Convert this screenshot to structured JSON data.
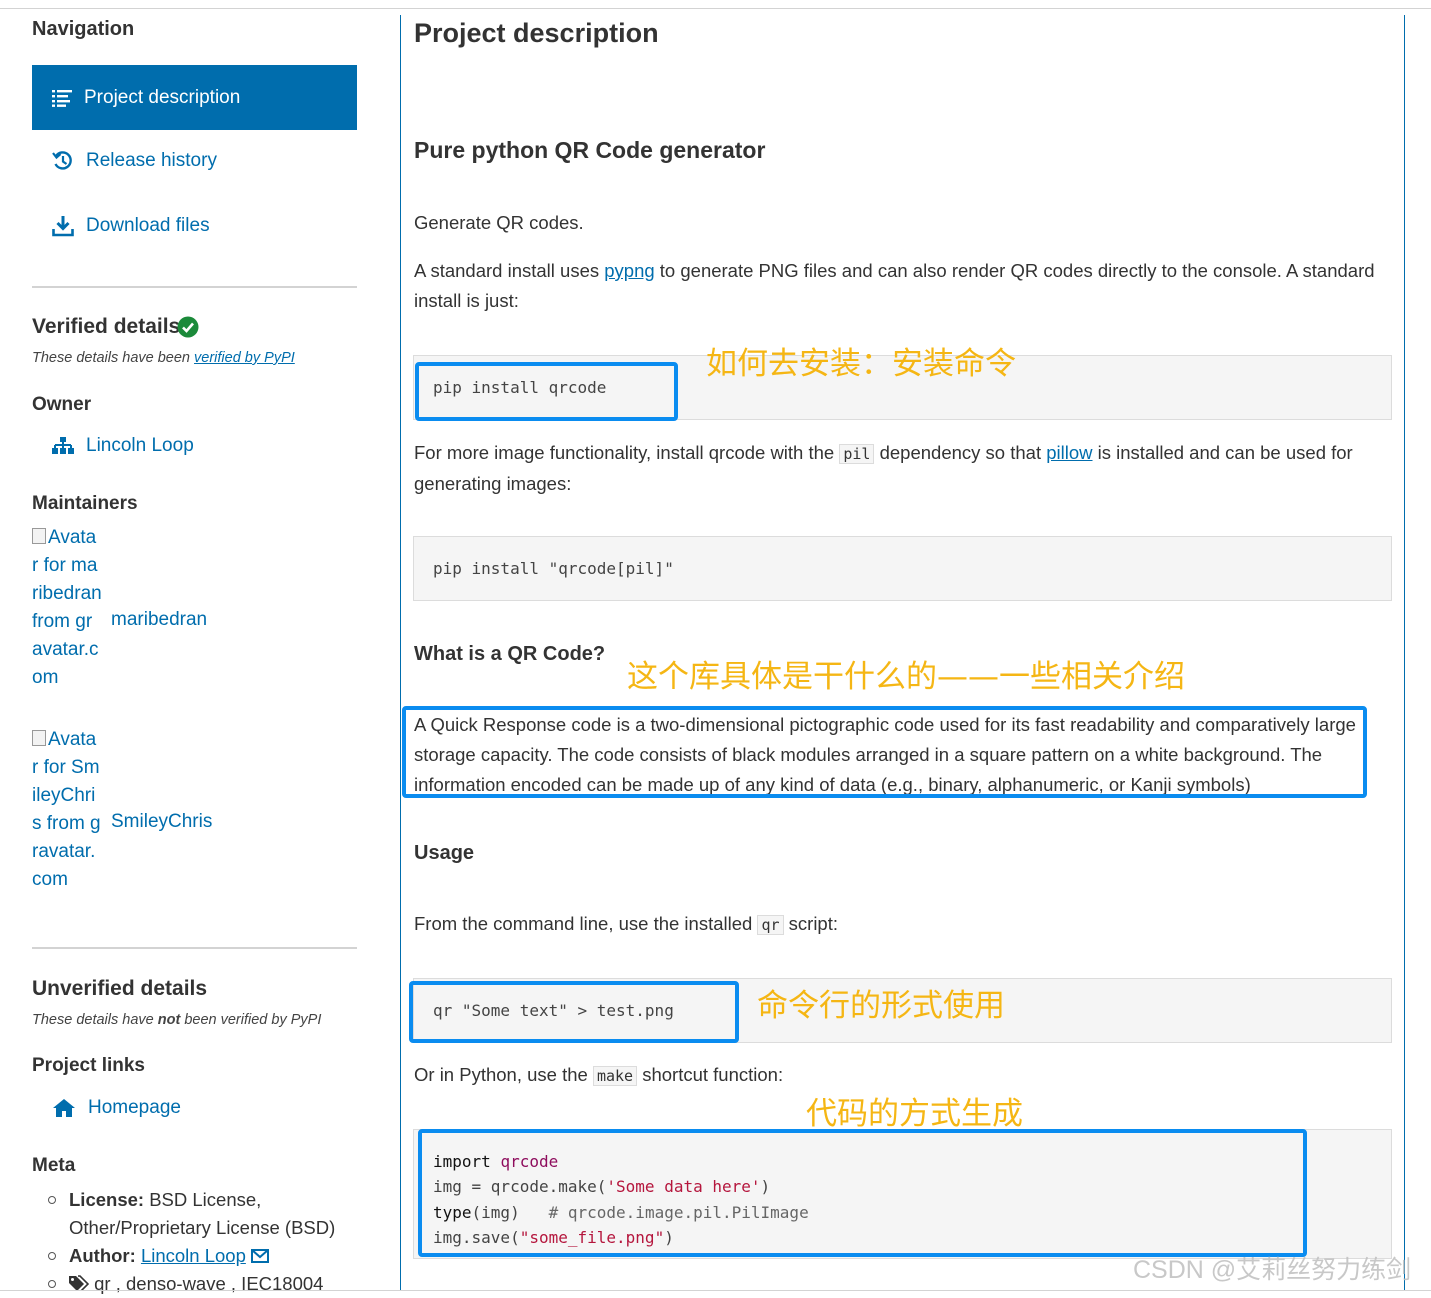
{
  "sidebar": {
    "navigation_heading": "Navigation",
    "nav": [
      {
        "label": "Project description",
        "icon": "align-left-icon"
      },
      {
        "label": "Release history",
        "icon": "history-icon"
      },
      {
        "label": "Download files",
        "icon": "download-icon"
      }
    ],
    "verified": {
      "heading": "Verified details",
      "note_prefix": "These details have been ",
      "note_link": "verified by PyPI",
      "icon": "check-circle-icon"
    },
    "owner": {
      "heading": "Owner",
      "name": "Lincoln Loop",
      "icon": "sitemap-icon"
    },
    "maintainers": {
      "heading": "Maintainers",
      "items": [
        {
          "avatar_alt": "Avatar for maribedran from gravatar.com",
          "name": "maribedran"
        },
        {
          "avatar_alt": "Avatar for SmileyChris from gravatar.com",
          "name": "SmileyChris"
        }
      ]
    },
    "unverified": {
      "heading": "Unverified details",
      "note_prefix": "These details have ",
      "note_bold": "not",
      "note_suffix": " been verified by PyPI"
    },
    "project_links": {
      "heading": "Project links",
      "homepage": "Homepage",
      "icon": "home-icon"
    },
    "meta": {
      "heading": "Meta",
      "license_label": "License:",
      "license_value_1": " BSD License,",
      "license_value_2": "Other/Proprietary License (BSD)",
      "author_label": "Author:",
      "author_value": "Lincoln Loop",
      "tags_value": "qr , denso-wave , IEC18004"
    }
  },
  "main": {
    "title": "Project description",
    "h_generator": "Pure python QR Code generator",
    "p_generate": "Generate QR codes.",
    "p_standard_1": "A standard install uses ",
    "p_standard_link": "pypng",
    "p_standard_2": " to generate PNG files and can also render QR codes directly to the console. A standard install is just:",
    "code_install": "pip install qrcode",
    "p_more_1": "For more image functionality, install qrcode with the ",
    "p_more_code": "pil",
    "p_more_2": " dependency so that ",
    "p_more_link": "pillow",
    "p_more_3": " is installed and can be used for generating images:",
    "code_install_pil": "pip install \"qrcode[pil]\"",
    "h_what": "What is a QR Code?",
    "p_what": "A Quick Response code is a two-dimensional pictographic code used for its fast readability and comparatively large storage capacity. The code consists of black modules arranged in a square pattern on a white background. The information encoded can be made up of any kind of data (e.g., binary, alphanumeric, or Kanji symbols)",
    "h_usage": "Usage",
    "p_cli_1": "From the command line, use the installed ",
    "p_cli_code": "qr",
    "p_cli_2": " script:",
    "code_cli": "qr \"Some text\" > test.png",
    "p_python_1": "Or in Python, use the ",
    "p_python_code": "make",
    "p_python_2": " shortcut function:",
    "code_py": {
      "l1_kw": "import",
      "l1_mod": "qrcode",
      "l2_a": "img = qrcode.make(",
      "l2_str": "'Some data here'",
      "l2_b": ")",
      "l3_kw": "type",
      "l3_a": "(img)  ",
      "l3_cmt": "# qrcode.image.pil.PilImage",
      "l4_a": "img.save(",
      "l4_str": "\"some_file.png\"",
      "l4_b": ")"
    }
  },
  "annotations": {
    "install": "如何去安装：安装命令",
    "intro": "这个库具体是干什么的——一些相关介绍",
    "cli": "命令行的形式使用",
    "code": "代码的方式生成",
    "highlight_color": "#0a8cf0",
    "text_color": "#f5b614"
  },
  "watermark": "CSDN @艾莉丝努力练剑",
  "colors": {
    "accent": "#006dad"
  }
}
